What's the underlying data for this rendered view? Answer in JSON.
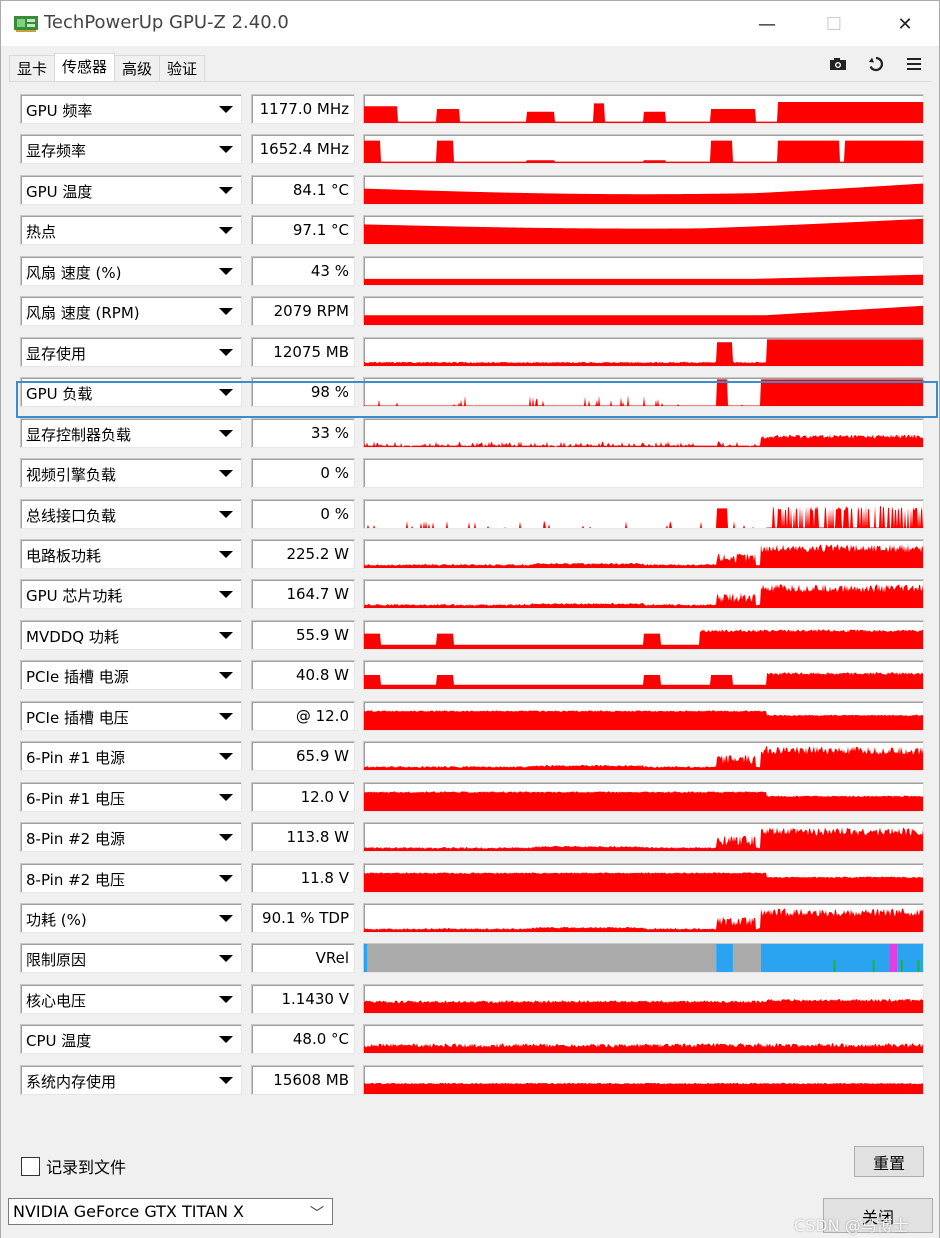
{
  "window": {
    "title": "TechPowerUp GPU-Z 2.40.0",
    "minimize_icon": "minimize-icon",
    "maximize_icon": "maximize-icon",
    "close_icon": "close-icon"
  },
  "tabs": [
    {
      "label": "显卡",
      "active": false
    },
    {
      "label": "传感器",
      "active": true
    },
    {
      "label": "高级",
      "active": false
    },
    {
      "label": "验证",
      "active": false
    }
  ],
  "toolbar": {
    "icons": [
      "camera-icon",
      "refresh-icon",
      "menu-icon"
    ]
  },
  "colors": {
    "graph": "#ff0000",
    "perfcap_gray": "#aaaaaa",
    "perfcap_blue": "#2aa3f0",
    "perfcap_magenta": "#e040e0",
    "perfcap_green": "#20b040",
    "highlight": "#3c8cd0"
  },
  "sensors": [
    {
      "name": "GPU 频率",
      "value": "1177.0 MHz",
      "graph": "clock"
    },
    {
      "name": "显存频率",
      "value": "1652.4 MHz",
      "graph": "memclock"
    },
    {
      "name": "GPU 温度",
      "value": "84.1 °C",
      "graph": "temp"
    },
    {
      "name": "热点",
      "value": "97.1 °C",
      "graph": "hotspot"
    },
    {
      "name": "风扇 速度 (%)",
      "value": "43 %",
      "graph": "fanpct"
    },
    {
      "name": "风扇 速度 (RPM)",
      "value": "2079 RPM",
      "graph": "fanrpm"
    },
    {
      "name": "显存使用",
      "value": "12075 MB",
      "graph": "memused"
    },
    {
      "name": "GPU 负载",
      "value": "98 %",
      "graph": "gpuload"
    },
    {
      "name": "显存控制器负载",
      "value": "33 %",
      "graph": "mcload"
    },
    {
      "name": "视频引擎负载",
      "value": "0 %",
      "graph": "empty"
    },
    {
      "name": "总线接口负载",
      "value": "0 %",
      "graph": "busload"
    },
    {
      "name": "电路板功耗",
      "value": "225.2 W",
      "graph": "power"
    },
    {
      "name": "GPU 芯片功耗",
      "value": "164.7 W",
      "graph": "power"
    },
    {
      "name": "MVDDQ 功耗",
      "value": "55.9 W",
      "graph": "mvddq"
    },
    {
      "name": "PCIe 插槽 电源",
      "value": "40.8 W",
      "graph": "pcie"
    },
    {
      "name": "PCIe 插槽 电压",
      "value": "@ 12.0",
      "graph": "voltage"
    },
    {
      "name": "6-Pin #1 电源",
      "value": "65.9 W",
      "graph": "power"
    },
    {
      "name": "6-Pin #1 电压",
      "value": "12.0 V",
      "graph": "voltage"
    },
    {
      "name": "8-Pin #2 电源",
      "value": "113.8 W",
      "graph": "power"
    },
    {
      "name": "8-Pin #2 电压",
      "value": "11.8 V",
      "graph": "voltage"
    },
    {
      "name": "功耗 (%)",
      "value": "90.1 % TDP",
      "graph": "powerpct"
    },
    {
      "name": "限制原因",
      "value": "VRel",
      "graph": "perfcap"
    },
    {
      "name": "核心电压",
      "value": "1.1430 V",
      "graph": "vcore"
    },
    {
      "name": "CPU 温度",
      "value": "48.0 °C",
      "graph": "cputemp"
    },
    {
      "name": "系统内存使用",
      "value": "15608 MB",
      "graph": "sysmem"
    }
  ],
  "footer": {
    "log_label": "记录到文件",
    "reset_label": "重置",
    "close_label": "关闭",
    "gpu_selected": "NVIDIA GeForce GTX TITAN X"
  },
  "watermark": "CSDN @马博士"
}
